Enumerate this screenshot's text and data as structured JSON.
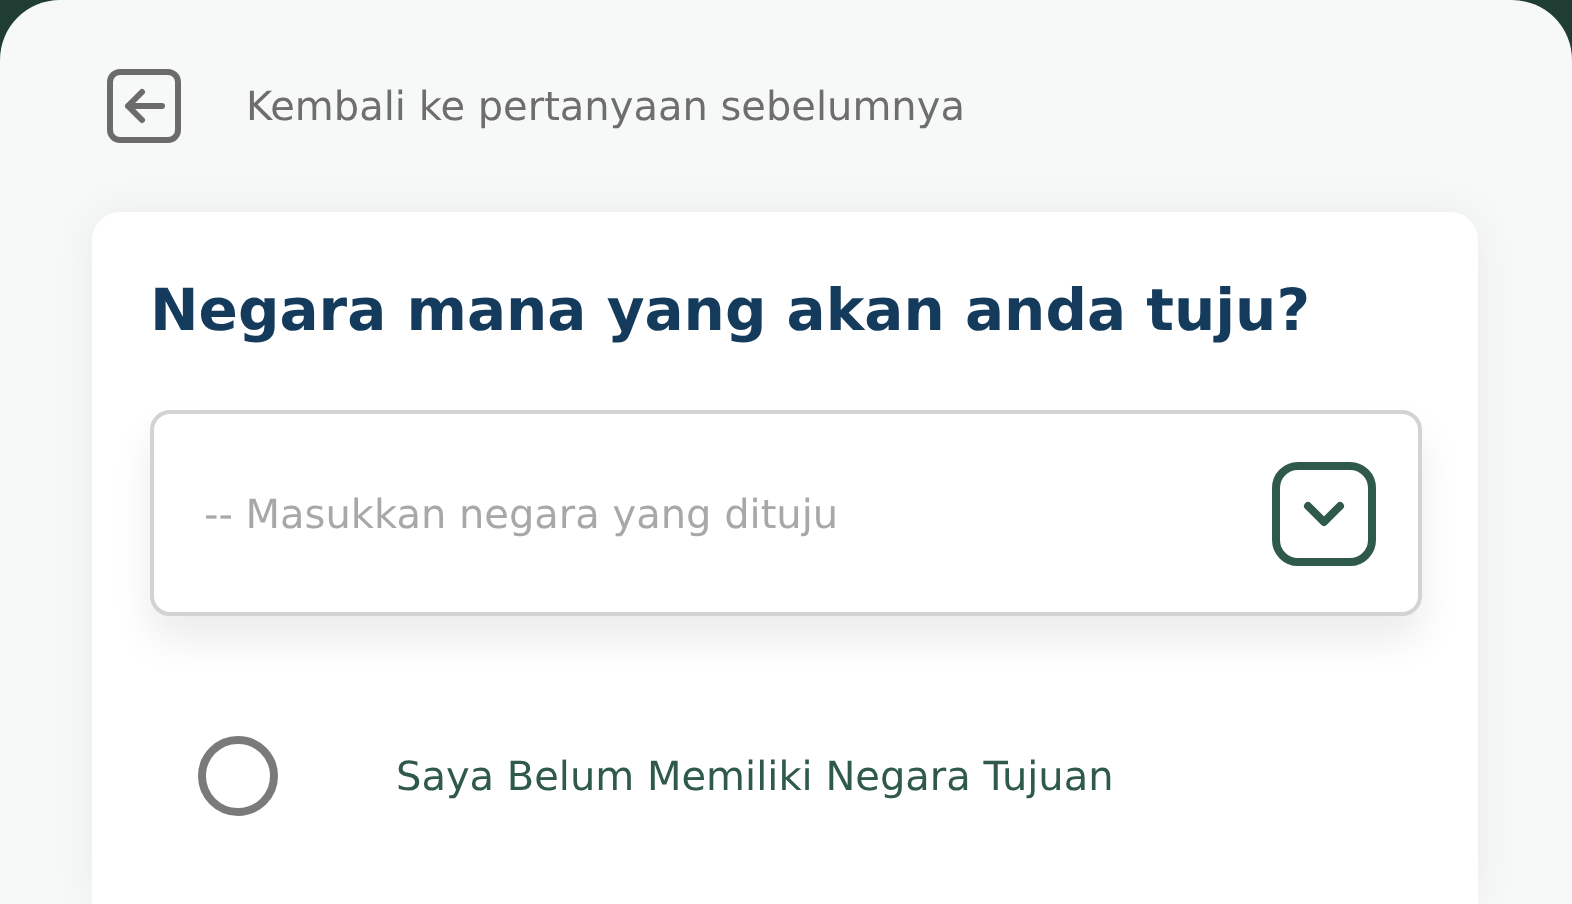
{
  "back_link": {
    "label": "Kembali ke pertanyaan sebelumnya"
  },
  "question": {
    "title": "Negara mana yang akan anda tuju?"
  },
  "country_select": {
    "placeholder": "-- Masukkan negara yang dituju"
  },
  "options": [
    {
      "label": "Saya Belum Memiliki Negara Tujuan",
      "selected": false
    }
  ]
}
